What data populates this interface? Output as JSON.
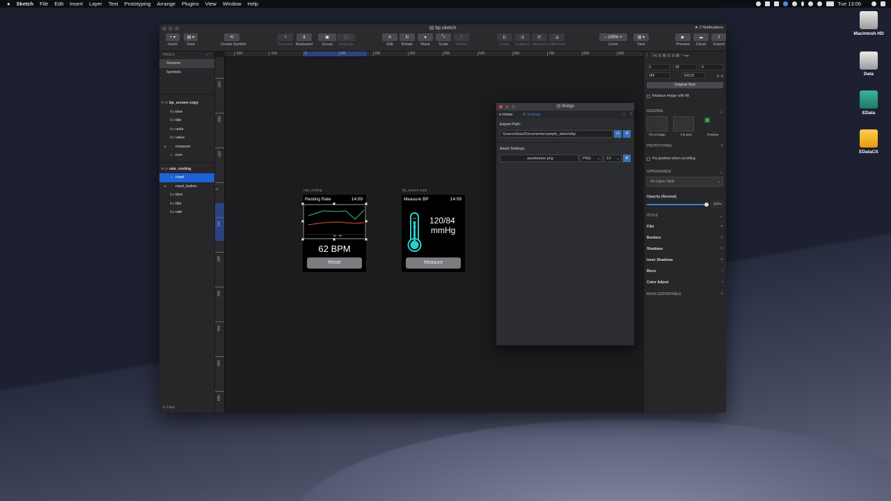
{
  "menubar": {
    "app": "Sketch",
    "items": [
      "File",
      "Edit",
      "Insert",
      "Layer",
      "Text",
      "Prototyping",
      "Arrange",
      "Plugins",
      "View",
      "Window",
      "Help"
    ],
    "clock": "Tue 13:06"
  },
  "desktop": {
    "icons": [
      "Macintosh HD",
      "Data",
      "EData",
      "EDataCS"
    ]
  },
  "window": {
    "title": "bp.sketch",
    "notifications": "★ 2 Notifications"
  },
  "toolbar": {
    "items": [
      {
        "label": "Insert",
        "glyph": "+ ▾",
        "dim": false
      },
      {
        "label": "Data",
        "glyph": "▤ ▾",
        "dim": false
      },
      {
        "label": "Create Symbol",
        "glyph": "⟲",
        "dim": false
      },
      {
        "label": "Forward",
        "glyph": "⇞",
        "dim": true
      },
      {
        "label": "Backward",
        "glyph": "⇟",
        "dim": false
      },
      {
        "label": "Group",
        "glyph": "▣",
        "dim": false
      },
      {
        "label": "Ungroup",
        "glyph": "▢",
        "dim": true
      },
      {
        "label": "Edit",
        "glyph": "A",
        "dim": false
      },
      {
        "label": "Rotate",
        "glyph": "↻",
        "dim": false
      },
      {
        "label": "Mask",
        "glyph": "●",
        "dim": false
      },
      {
        "label": "Scale",
        "glyph": "⤡",
        "dim": false
      },
      {
        "label": "Flatten",
        "glyph": "⌇",
        "dim": true
      },
      {
        "label": "Union",
        "glyph": "◧",
        "dim": true
      },
      {
        "label": "Subtract",
        "glyph": "◨",
        "dim": true
      },
      {
        "label": "Intersect",
        "glyph": "◩",
        "dim": true
      },
      {
        "label": "Difference",
        "glyph": "◪",
        "dim": true
      },
      {
        "label": "Zoom",
        "glyph": "–  100%  +",
        "dim": false
      },
      {
        "label": "View",
        "glyph": "▥ ▾",
        "dim": false
      },
      {
        "label": "Preview",
        "glyph": "▶",
        "dim": false
      },
      {
        "label": "Cloud",
        "glyph": "☁",
        "dim": false
      },
      {
        "label": "Export",
        "glyph": "⇪",
        "dim": false
      }
    ]
  },
  "layers": {
    "pages_header": "PAGES",
    "pages": [
      "Screens",
      "Symbols"
    ],
    "groups": [
      {
        "name": "bp_screen copy",
        "children": [
          {
            "name": "time",
            "icon": "Aa"
          },
          {
            "name": "title",
            "icon": "Aa"
          },
          {
            "name": "units",
            "icon": "Aa"
          },
          {
            "name": "value",
            "icon": "Aa"
          },
          {
            "name": "measure",
            "icon": "◌"
          },
          {
            "name": "icon",
            "icon": "▭"
          }
        ]
      },
      {
        "name": "rate_resting",
        "children": [
          {
            "name": "chart",
            "icon": "▭"
          },
          {
            "name": "reset_button",
            "icon": "◌"
          },
          {
            "name": "time",
            "icon": "Aa"
          },
          {
            "name": "title",
            "icon": "Aa"
          },
          {
            "name": "rate",
            "icon": "Aa"
          }
        ]
      }
    ],
    "filter": "Filter"
  },
  "rulers": {
    "h": [
      "-200",
      "-100",
      "0",
      "100",
      "200",
      "300",
      "400",
      "500",
      "600",
      "700",
      "800",
      "900"
    ],
    "v": [
      "-300",
      "-200",
      "-100",
      "0",
      "100",
      "200",
      "300",
      "400",
      "500",
      "600"
    ]
  },
  "artboards": [
    {
      "label": "rate_resting",
      "title": "Resting Rate",
      "time": "14:09",
      "value": "62 BPM",
      "button": "Reset"
    },
    {
      "label": "bp_screen copy",
      "title": "Measure BP",
      "time": "14:09",
      "value": "120/84",
      "units": "mmHg",
      "button": "Measure"
    }
  ],
  "qt_bridge": {
    "title": "Qt Bridge",
    "tabs": [
      "Home",
      "Settings"
    ],
    "export_label": "Export Path:",
    "export_path": "/Users/vikas/Documents/sample_sketch/bp",
    "asset_label": "Asset Settings:",
    "asset_name": "assetname.png",
    "format": "PNG",
    "scale": "1X"
  },
  "inspector": {
    "x": "0",
    "y": "28",
    "rot": "0",
    "w": "184",
    "h": "100,52",
    "original_size": "Original Size",
    "replace_fill": "Replace image with fill",
    "resizing": "RESIZING",
    "resize_opts": [
      "Pin to Edge",
      "Fix Size",
      "Preview"
    ],
    "prototyping": "PROTOTYPING",
    "fix_scroll": "Fix position when scrolling",
    "appearance": "APPEARANCE",
    "layer_style": "No Layer Style",
    "opacity_label": "Opacity (Normal)",
    "opacity": "100%",
    "style": "STYLE",
    "sections": [
      "Fills",
      "Borders",
      "Shadows",
      "Inner Shadows",
      "Blurs",
      "Color Adjust"
    ],
    "make_exportable": "MAKE EXPORTABLE"
  }
}
